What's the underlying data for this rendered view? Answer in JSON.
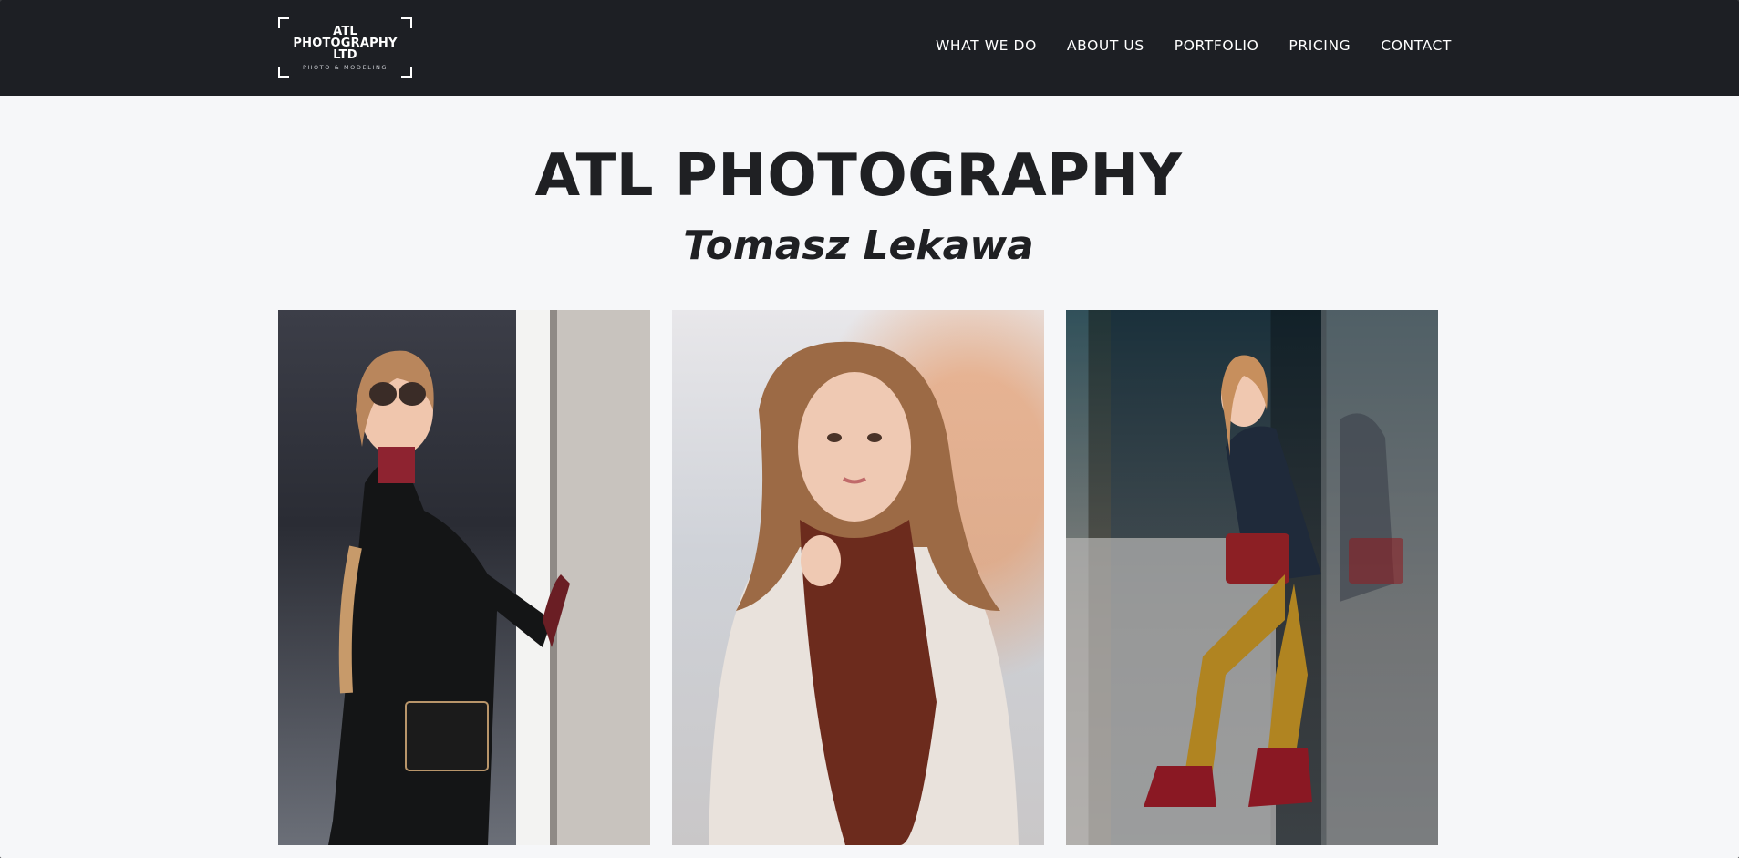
{
  "brand": {
    "logo_line1": "ATL",
    "logo_line2": "PHOTOGRAPHY",
    "logo_line3": "LTD",
    "logo_tagline": "PHOTO & MODELING"
  },
  "nav": {
    "items": [
      {
        "label": "WHAT WE DO"
      },
      {
        "label": "ABOUT US"
      },
      {
        "label": "PORTFOLIO"
      },
      {
        "label": "PRICING"
      },
      {
        "label": "CONTACT"
      }
    ]
  },
  "hero": {
    "title": "ATL PHOTOGRAPHY",
    "subtitle": "Tomasz Lekawa"
  },
  "colors": {
    "navbar_bg": "#1d1f24",
    "page_bg": "#f6f7f9",
    "text_dark": "#1f2023",
    "nav_text": "#ffffff"
  }
}
